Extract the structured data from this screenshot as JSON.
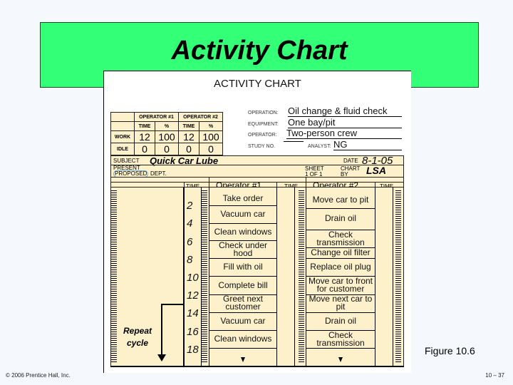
{
  "slide": {
    "title": "Activity Chart",
    "figure_label": "Figure 10.6",
    "copyright": "© 2006 Prentice Hall, Inc.",
    "page_number": "10 – 37"
  },
  "form": {
    "title": "ACTIVITY CHART",
    "summary": {
      "operator1_label": "OPERATOR #1",
      "operator2_label": "OPERATOR #2",
      "time_label": "TIME",
      "pct_label": "%",
      "work_label": "WORK",
      "idle_label": "IDLE",
      "work": {
        "op1_time": "12",
        "op1_pct": "100",
        "op2_time": "12",
        "op2_pct": "100"
      },
      "idle": {
        "op1_time": "0",
        "op1_pct": "0",
        "op2_time": "0",
        "op2_pct": "0"
      }
    },
    "info": {
      "operation_label": "OPERATION:",
      "operation": "Oil change & fluid check",
      "equipment_label": "EQUIPMENT:",
      "equipment": "One bay/pit",
      "operator_label": "OPERATOR:",
      "operator": "Two-person crew",
      "study_label": "STUDY NO.",
      "study": "",
      "analyst_label": "ANALYST:",
      "analyst": "NG"
    },
    "header": {
      "subject_label": "SUBJECT",
      "subject": "Quick Car Lube",
      "date_label": "DATE",
      "date": "8-1-05",
      "present_label": "PRESENT",
      "proposed_label": "PROPOSED",
      "dept_label": "DEPT.",
      "sheet_label": "SHEET 1 OF 1",
      "chart_by_label": "CHART BY",
      "chart_by": "LSA"
    },
    "columns": {
      "time": "TIME",
      "operator1": "Operator #1",
      "operator2": "Operator #2"
    },
    "time_marks": [
      "2",
      "4",
      "6",
      "8",
      "10",
      "12",
      "14",
      "16",
      "18"
    ],
    "operator1_tasks": [
      {
        "label": "Take order",
        "start": 0,
        "end": 1.5
      },
      {
        "label": "Vacuum car",
        "start": 1.5,
        "end": 3.5
      },
      {
        "label": "Clean windows",
        "start": 3.5,
        "end": 5.4
      },
      {
        "label": "Check under hood",
        "start": 5.4,
        "end": 7.4
      },
      {
        "label": "Fill with oil",
        "start": 7.4,
        "end": 9.4
      },
      {
        "label": "Complete bill",
        "start": 9.4,
        "end": 11.4
      },
      {
        "label": "Greet next customer",
        "start": 11.4,
        "end": 13.4
      },
      {
        "label": "Vacuum car",
        "start": 13.4,
        "end": 15.4
      },
      {
        "label": "Clean windows",
        "start": 15.4,
        "end": 17.4
      }
    ],
    "operator2_tasks": [
      {
        "label": "Move car to pit",
        "start": 0,
        "end": 1.8
      },
      {
        "label": "Drain oil",
        "start": 1.8,
        "end": 4.2
      },
      {
        "label": "Check transmission",
        "start": 4.2,
        "end": 6.2
      },
      {
        "label": "Change oil filter",
        "start": 6.2,
        "end": 7.4
      },
      {
        "label": "Replace oil plug",
        "start": 7.4,
        "end": 9.4
      },
      {
        "label": "Move car to front for customer",
        "start": 9.4,
        "end": 11.4
      },
      {
        "label": "Move next car to pit",
        "start": 11.4,
        "end": 13.4
      },
      {
        "label": "Drain oil",
        "start": 13.4,
        "end": 15.4
      },
      {
        "label": "Check transmission",
        "start": 15.4,
        "end": 17.4
      }
    ],
    "repeat_note": "Repeat cycle"
  }
}
